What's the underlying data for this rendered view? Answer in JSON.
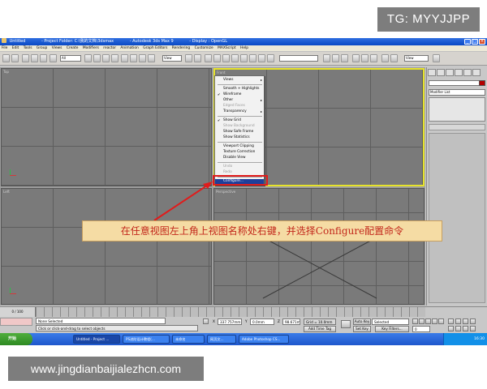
{
  "watermarks": {
    "tg": "TG: MYYJJPP",
    "site": "www.jingdianbaijialezhcn.com"
  },
  "titlebar": {
    "segments": [
      "Untitled",
      "- Project Folder: C:\\我的文档\\3dsmax",
      "- Autodesk 3ds Max 9",
      "- Display : OpenGL"
    ]
  },
  "window_buttons": [
    "_",
    "□",
    "×"
  ],
  "menubar": [
    "File",
    "Edit",
    "Tools",
    "Group",
    "Views",
    "Create",
    "Modifiers",
    "reactor",
    "Animation",
    "Graph Editors",
    "Rendering",
    "Customize",
    "MAXScript",
    "Help"
  ],
  "toolbar": {
    "selection_filter": "All",
    "ref_coord": "View",
    "named_selection": "",
    "render_view": "View"
  },
  "viewports": [
    {
      "label": "Top"
    },
    {
      "label": "Front"
    },
    {
      "label": "Left"
    },
    {
      "label": "Perspective"
    }
  ],
  "context_menu": {
    "items": [
      {
        "label": "Views",
        "state": "sub"
      },
      {
        "label": "Smooth + Highlights",
        "state": "normal"
      },
      {
        "label": "Wireframe",
        "state": "checked"
      },
      {
        "label": "Other",
        "state": "sub"
      },
      {
        "label": "Edged Faces",
        "state": "disabled"
      },
      {
        "label": "Transparency",
        "state": "sub"
      },
      {
        "label": "Show Grid",
        "state": "checked"
      },
      {
        "label": "Show Background",
        "state": "disabled"
      },
      {
        "label": "Show Safe Frame",
        "state": "normal"
      },
      {
        "label": "Show Statistics",
        "state": "normal"
      },
      {
        "label": "Viewport Clipping",
        "state": "normal"
      },
      {
        "label": "Texture Correction",
        "state": "normal"
      },
      {
        "label": "Disable View",
        "state": "normal"
      },
      {
        "label": "Undo",
        "state": "disabled"
      },
      {
        "label": "Redo",
        "state": "disabled"
      },
      {
        "label": "Configure...",
        "state": "highlighted"
      }
    ]
  },
  "command_panel": {
    "modifier_list": "Modifier List"
  },
  "callout": {
    "text": "在任意视图左上角上视图名称处右键，并选择Configure配置命令"
  },
  "status": {
    "time_slider": "0 / 100",
    "selection": "None Selected",
    "prompt": "Click or click-and-drag to select objects",
    "x_label": "X",
    "x_value": "337.757mm",
    "y_label": "Y",
    "y_value": "0.0mm",
    "z_label": "Z",
    "z_value": "98.671mm",
    "grid": "Grid = 10.0mm",
    "add_time_tag": "Add Time Tag",
    "auto_key": "Auto Key",
    "key_mode": "Selected",
    "set_key": "Set Key",
    "key_filters": "Key Filters...",
    "frame": "0"
  },
  "taskbar": {
    "start": "开始",
    "items": [
      {
        "label": "Untitled - Project ..."
      },
      {
        "label": "PS进阶设计教程(..."
      },
      {
        "label": "未命名"
      },
      {
        "label": "网页文..."
      },
      {
        "label": "Adobe Photoshop CS..."
      }
    ],
    "clock": "16:30"
  }
}
